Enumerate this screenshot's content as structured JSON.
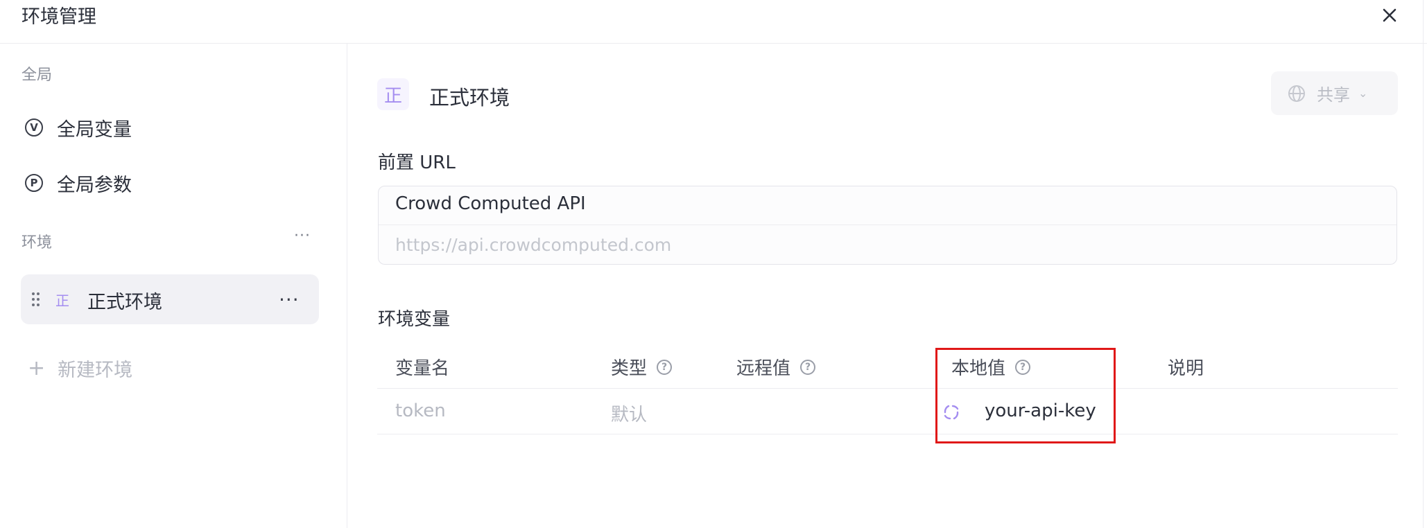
{
  "dialog": {
    "title": "环境管理",
    "close_icon": "close-icon"
  },
  "sidebar": {
    "global_section": "全局",
    "global_items": [
      {
        "icon": "V",
        "label": "全局变量"
      },
      {
        "icon": "P",
        "label": "全局参数"
      }
    ],
    "env_section": "环境",
    "env_more": "···",
    "environments": [
      {
        "badge": "正",
        "label": "正式环境",
        "more": "···"
      }
    ],
    "new_env_label": "新建环境"
  },
  "main": {
    "env_badge": "正",
    "env_name": "正式环境",
    "share_label": "共享",
    "prefix_url_label": "前置 URL",
    "service_name": "Crowd Computed API",
    "url_placeholder": "https://api.crowdcomputed.com",
    "env_vars_label": "环境变量",
    "columns": [
      "变量名",
      "类型",
      "远程值",
      "本地值",
      "说明"
    ],
    "rows": [
      {
        "name": "token",
        "type": "默认",
        "remote": "",
        "local": "your-api-key",
        "desc": ""
      }
    ]
  },
  "colors": {
    "accent": "#a48df0",
    "highlight_border": "#e01818",
    "muted_text": "#b6b9c2"
  }
}
